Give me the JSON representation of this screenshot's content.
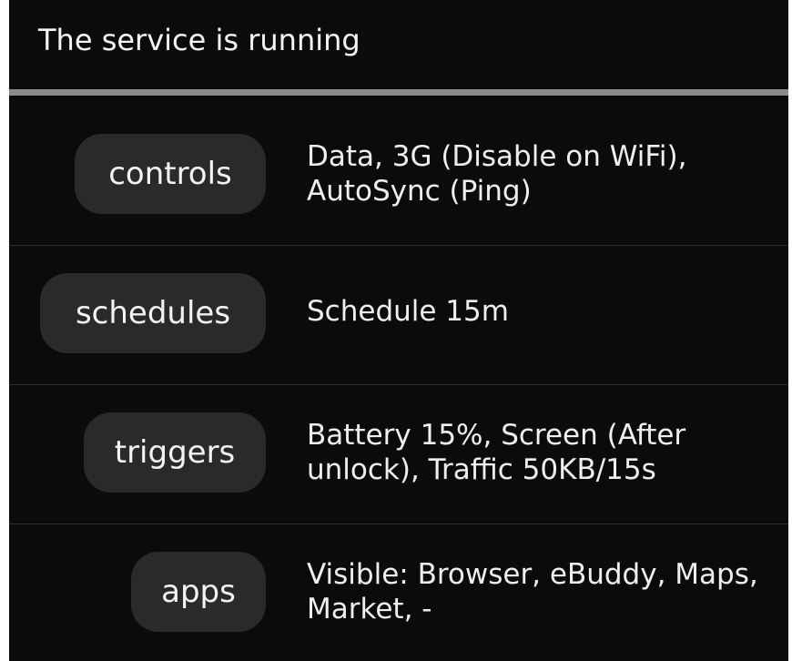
{
  "header": {
    "status_text": "The service is running"
  },
  "rows": [
    {
      "button_label": "controls",
      "description": "Data, 3G (Disable on WiFi), AutoSync (Ping)"
    },
    {
      "button_label": "schedules",
      "description": "Schedule 15m"
    },
    {
      "button_label": "triggers",
      "description": "Battery 15%, Screen (After unlock), Traffic 50KB/15s"
    },
    {
      "button_label": "apps",
      "description": "Visible: Browser, eBuddy, Maps, Market,  -"
    }
  ],
  "colors": {
    "background": "#0b0b0b",
    "pill": "#2a2b28",
    "header_divider": "#8a8a8a",
    "row_divider": "#2d2d2d",
    "text": "#f2f2f2"
  }
}
